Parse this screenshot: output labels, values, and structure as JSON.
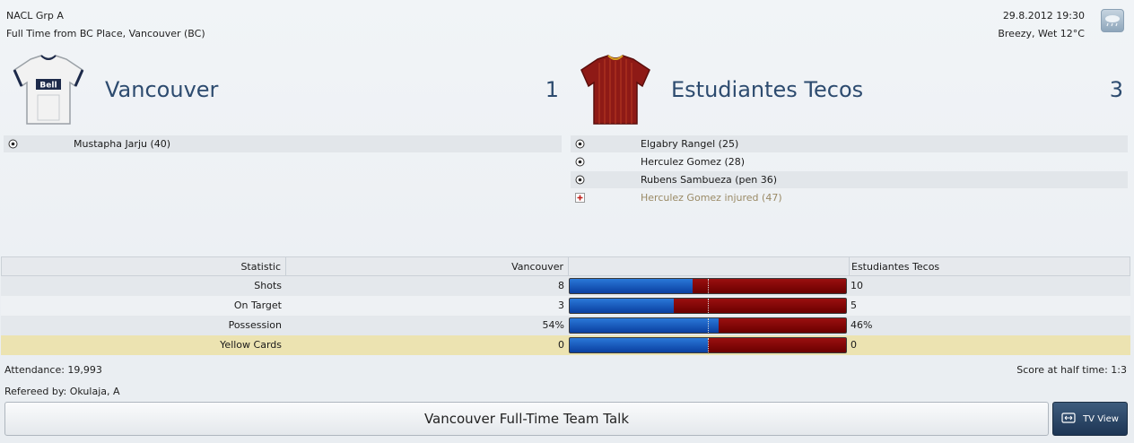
{
  "match": {
    "competition": "NACL Grp A",
    "venue_line": "Full Time from BC Place, Vancouver (BC)",
    "datetime": "29.8.2012 19:30",
    "weather": "Breezy, Wet 12°C",
    "weather_icon": "rain-cloud-icon"
  },
  "home": {
    "name": "Vancouver",
    "score": "1",
    "kit_colors": {
      "primary": "#f2f2f2",
      "trim": "#1d2a4a"
    },
    "kit_sponsor": "Bell",
    "events": [
      {
        "type": "goal",
        "icon": "ball-icon",
        "text": "Mustapha Jarju (40)"
      }
    ]
  },
  "away": {
    "name": "Estudiantes Tecos",
    "score": "3",
    "kit_colors": {
      "primary": "#8e1a16",
      "trim": "#d6a020"
    },
    "events": [
      {
        "type": "goal",
        "icon": "ball-icon",
        "text": "Elgabry Rangel (25)"
      },
      {
        "type": "goal",
        "icon": "ball-icon",
        "text": "Herculez Gomez (28)"
      },
      {
        "type": "goal",
        "icon": "ball-icon",
        "text": "Rubens Sambueza (pen 36)"
      },
      {
        "type": "injury",
        "icon": "injury-cross-icon",
        "text": "Herculez Gomez injured (47)"
      }
    ]
  },
  "stats": {
    "header": {
      "statistic": "Statistic",
      "home": "Vancouver",
      "away": "Estudiantes Tecos"
    },
    "rows": [
      {
        "label": "Shots",
        "home": "8",
        "away": "10",
        "home_share": 0.444
      },
      {
        "label": "On Target",
        "home": "3",
        "away": "5",
        "home_share": 0.375
      },
      {
        "label": "Possession",
        "home": "54%",
        "away": "46%",
        "home_share": 0.54
      },
      {
        "label": "Yellow Cards",
        "home": "0",
        "away": "0",
        "home_share": 0.5
      }
    ],
    "bar_colors": {
      "home": "#1a5cc4",
      "away": "#7a0606"
    }
  },
  "footer": {
    "attendance": "Attendance: 19,993",
    "half_time": "Score at half time: 1:3",
    "referee": "Refereed by: Okulaja, A",
    "team_talk_label": "Vancouver Full-Time Team Talk",
    "tv_view_label": "TV View"
  }
}
